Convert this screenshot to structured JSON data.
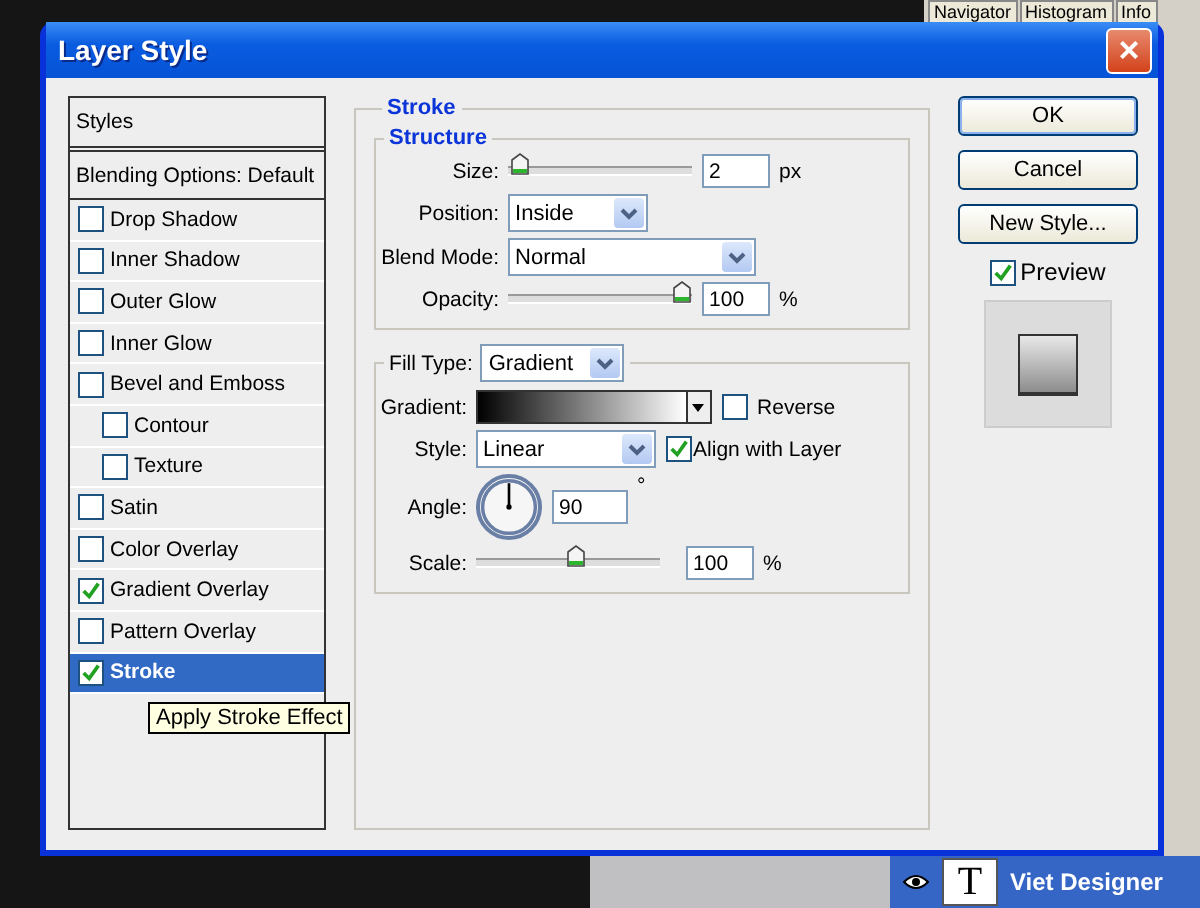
{
  "background": {
    "tabs": [
      "Navigator",
      "Histogram",
      "Info"
    ],
    "layer_icon": "T",
    "layer_name": "Viet Designer"
  },
  "window": {
    "title": "Layer Style",
    "close": "×"
  },
  "styles_list": {
    "header": "Styles",
    "blending": "Blending Options: Default",
    "items": [
      {
        "label": "Drop Shadow",
        "checked": false,
        "selected": false
      },
      {
        "label": "Inner Shadow",
        "checked": false,
        "selected": false
      },
      {
        "label": "Outer Glow",
        "checked": false,
        "selected": false
      },
      {
        "label": "Inner Glow",
        "checked": false,
        "selected": false
      },
      {
        "label": "Bevel and Emboss",
        "checked": false,
        "selected": false,
        "children": [
          {
            "label": "Contour",
            "checked": false,
            "selected": false
          },
          {
            "label": "Texture",
            "checked": false,
            "selected": false
          }
        ]
      },
      {
        "label": "Satin",
        "checked": false,
        "selected": false
      },
      {
        "label": "Color Overlay",
        "checked": false,
        "selected": false
      },
      {
        "label": "Gradient Overlay",
        "checked": true,
        "selected": false
      },
      {
        "label": "Pattern Overlay",
        "checked": false,
        "selected": false
      },
      {
        "label": "Stroke",
        "checked": true,
        "selected": true
      }
    ]
  },
  "tooltip": "Apply Stroke Effect",
  "stroke": {
    "title": "Stroke",
    "structure": {
      "title": "Structure",
      "size": {
        "label": "Size:",
        "level": 0.02,
        "value": "2",
        "unit": "px"
      },
      "position": {
        "label": "Position:",
        "value": "Inside"
      },
      "blend_mode": {
        "label": "Blend Mode:",
        "value": "Normal"
      },
      "opacity": {
        "label": "Opacity:",
        "level": 1,
        "value": "100",
        "unit": "%"
      }
    },
    "fill": {
      "label": "Fill Type:",
      "value": "Gradient",
      "gradient": {
        "label": "Gradient:"
      },
      "reverse": {
        "label": "Reverse",
        "checked": false
      },
      "style": {
        "label": "Style:",
        "value": "Linear"
      },
      "align": {
        "label": "Align with Layer",
        "checked": true
      },
      "angle": {
        "label": "Angle:",
        "value": "90",
        "unit": "°"
      },
      "scale": {
        "label": "Scale:",
        "level": 0.55,
        "value": "100",
        "unit": "%"
      }
    }
  },
  "buttons": [
    "OK",
    "Cancel",
    "New Style..."
  ],
  "preview": {
    "label": "Preview",
    "checked": true
  }
}
